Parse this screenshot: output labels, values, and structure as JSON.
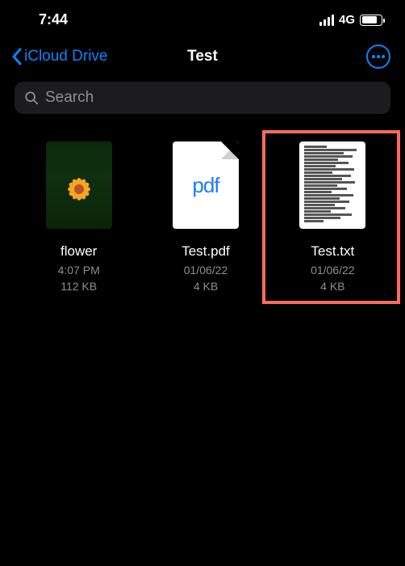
{
  "status": {
    "time": "7:44",
    "network": "4G"
  },
  "nav": {
    "back_label": "iCloud Drive",
    "title": "Test"
  },
  "search": {
    "placeholder": "Search"
  },
  "files": [
    {
      "name": "flower",
      "meta1": "4:07 PM",
      "meta2": "112 KB"
    },
    {
      "name": "Test.pdf",
      "meta1": "01/06/22",
      "meta2": "4 KB",
      "thumb_label": "pdf"
    },
    {
      "name": "Test.txt",
      "meta1": "01/06/22",
      "meta2": "4 KB"
    }
  ]
}
